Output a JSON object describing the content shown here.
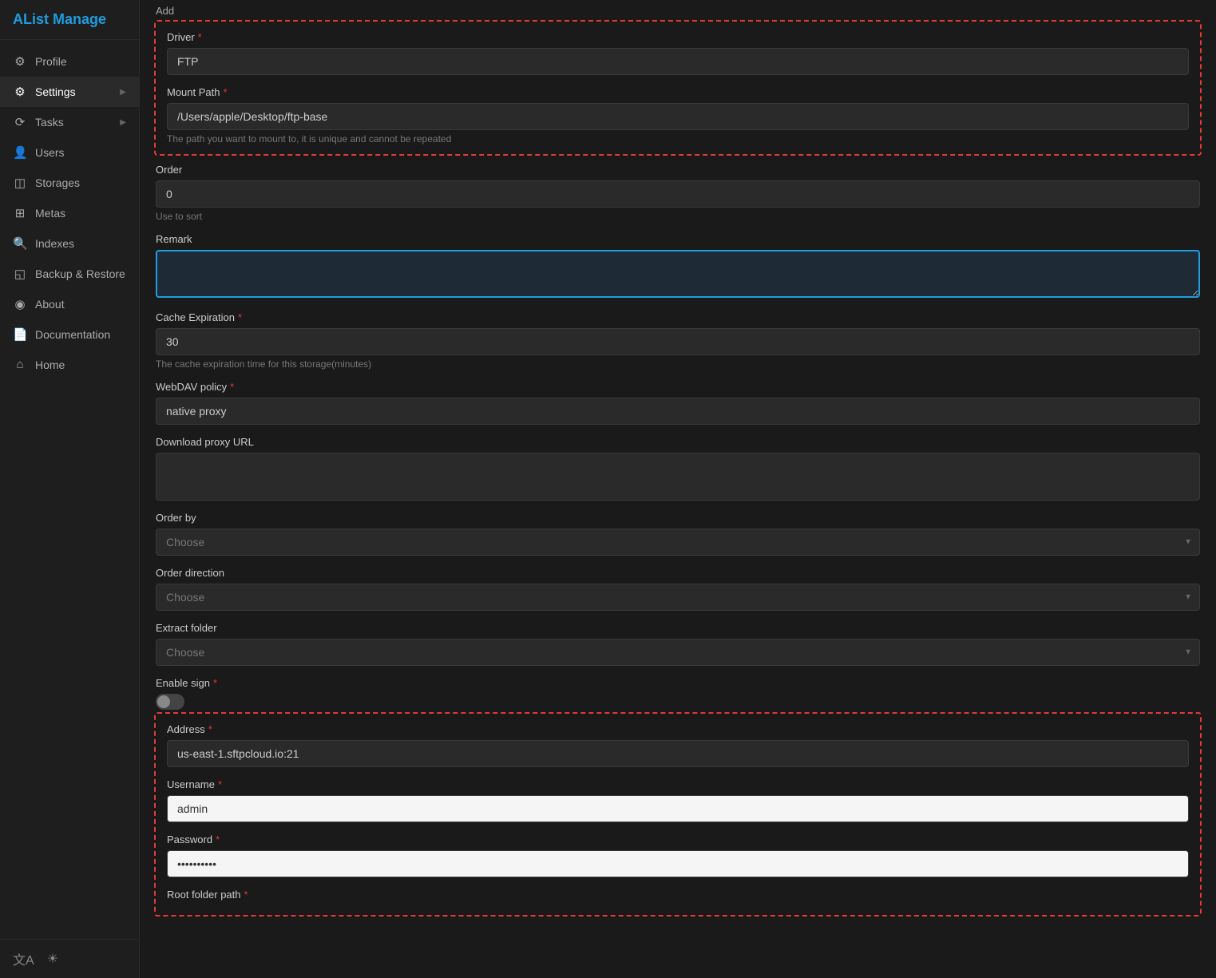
{
  "app": {
    "title": "AList Manage"
  },
  "sidebar": {
    "items": [
      {
        "id": "profile",
        "label": "Profile",
        "icon": "⚙",
        "icon_type": "gear",
        "active": false,
        "arrow": false
      },
      {
        "id": "settings",
        "label": "Settings",
        "icon": "⚙",
        "icon_type": "gear",
        "active": true,
        "arrow": true
      },
      {
        "id": "tasks",
        "label": "Tasks",
        "icon": "⟳",
        "icon_type": "tasks",
        "active": false,
        "arrow": true
      },
      {
        "id": "users",
        "label": "Users",
        "icon": "👤",
        "icon_type": "user",
        "active": false,
        "arrow": false
      },
      {
        "id": "storages",
        "label": "Storages",
        "icon": "◫",
        "icon_type": "storage",
        "active": false,
        "arrow": false
      },
      {
        "id": "metas",
        "label": "Metas",
        "icon": "⊞",
        "icon_type": "grid",
        "active": false,
        "arrow": false
      },
      {
        "id": "indexes",
        "label": "Indexes",
        "icon": "🔍",
        "icon_type": "search",
        "active": false,
        "arrow": false
      },
      {
        "id": "backup",
        "label": "Backup & Restore",
        "icon": "◱",
        "icon_type": "backup",
        "active": false,
        "arrow": false
      },
      {
        "id": "about",
        "label": "About",
        "icon": "◉",
        "icon_type": "info",
        "active": false,
        "arrow": false
      },
      {
        "id": "documentation",
        "label": "Documentation",
        "icon": "📄",
        "icon_type": "doc",
        "active": false,
        "arrow": false
      },
      {
        "id": "home",
        "label": "Home",
        "icon": "⌂",
        "icon_type": "home",
        "active": false,
        "arrow": false
      }
    ],
    "bottom": {
      "translate_icon": "文A",
      "theme_icon": "☀"
    }
  },
  "form": {
    "add_label": "Add",
    "sections": {
      "top_red_border": {
        "driver_label": "Driver",
        "driver_required": true,
        "driver_value": "FTP",
        "mount_path_label": "Mount Path",
        "mount_path_required": true,
        "mount_path_value": "/Users/apple/Desktop/ftp-base",
        "mount_path_hint": "The path you want to mount to, it is unique and cannot be repeated"
      },
      "order": {
        "label": "Order",
        "value": "0",
        "hint": "Use to sort"
      },
      "remark": {
        "label": "Remark",
        "value": ""
      },
      "cache_expiration": {
        "label": "Cache Expiration",
        "required": true,
        "value": "30",
        "hint": "The cache expiration time for this storage(minutes)"
      },
      "webdav_policy": {
        "label": "WebDAV policy",
        "required": true,
        "value": "native proxy"
      },
      "download_proxy_url": {
        "label": "Download proxy URL",
        "value": ""
      },
      "order_by": {
        "label": "Order by",
        "placeholder": "Choose"
      },
      "order_direction": {
        "label": "Order direction",
        "placeholder": "Choose"
      },
      "extract_folder": {
        "label": "Extract folder",
        "placeholder": "Choose"
      },
      "enable_sign": {
        "label": "Enable sign",
        "required": true,
        "enabled": false
      },
      "bottom_red_border": {
        "address_label": "Address",
        "address_required": true,
        "address_value": "us-east-1.sftpcloud.io:21",
        "username_label": "Username",
        "username_required": true,
        "username_value": "admin",
        "password_label": "Password",
        "password_required": true,
        "password_value": "••••••••••",
        "root_folder_label": "Root folder path",
        "root_folder_required": true
      }
    }
  }
}
